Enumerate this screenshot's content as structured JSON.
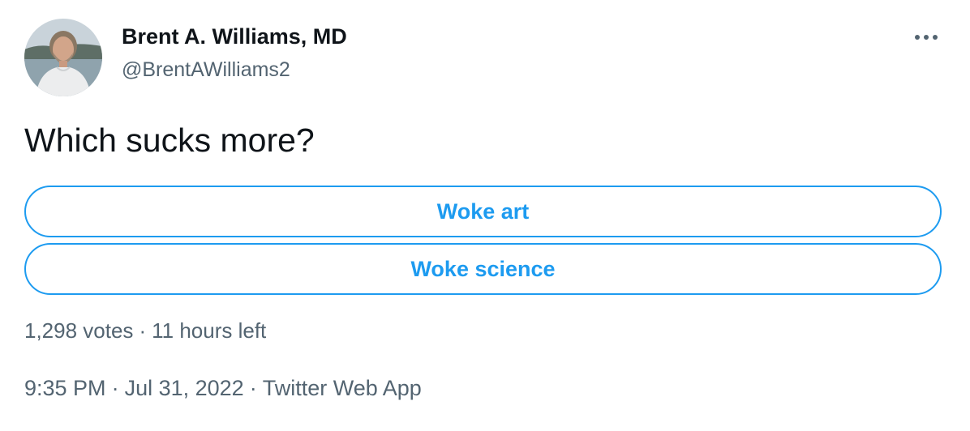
{
  "author": {
    "name": "Brent A. Williams, MD",
    "handle": "@BrentAWilliams2",
    "avatar_icon": "profile-photo"
  },
  "more_icon": "ellipsis-icon",
  "tweet": {
    "text": "Which sucks more?"
  },
  "poll": {
    "options": [
      {
        "label": "Woke art"
      },
      {
        "label": "Woke science"
      }
    ],
    "votes": "1,298 votes",
    "time_left": "11 hours left",
    "separator": "·"
  },
  "meta": {
    "time": "9:35 PM",
    "date": "Jul 31, 2022",
    "source": "Twitter Web App",
    "separator": "·"
  },
  "colors": {
    "accent": "#1d9bf0",
    "text_primary": "#0f1419",
    "text_secondary": "#536471",
    "background": "#ffffff"
  }
}
